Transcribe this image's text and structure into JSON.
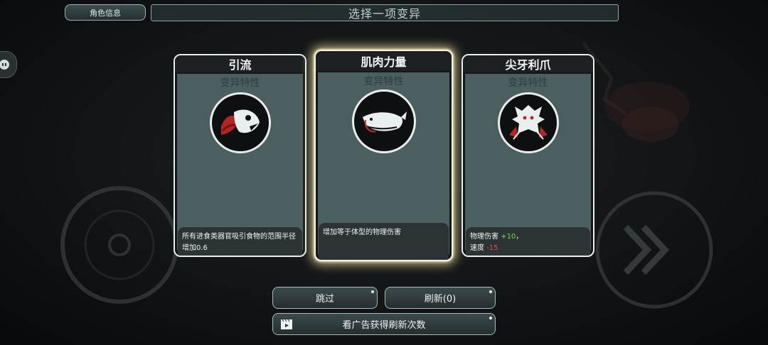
{
  "header": {
    "role_info_label": "角色信息",
    "title": "选择一项变异"
  },
  "cards": [
    {
      "title": "引流",
      "subtitle": "变异特性",
      "icon": "fish-head-emblem-icon",
      "description": "所有进食类器官吸引食物的范围半径增加0.6",
      "selected": false
    },
    {
      "title": "肌肉力量",
      "subtitle": "变异特性",
      "icon": "whale-emblem-icon",
      "description": "增加等于体型的物理伤害",
      "selected": true
    },
    {
      "title": "尖牙利爪",
      "subtitle": "变异特性",
      "icon": "beast-claws-emblem-icon",
      "stat1_label": "物理伤害",
      "stat1_value": "+10",
      "stat1_suffix": "，",
      "stat2_label": "速度",
      "stat2_value": "-15",
      "selected": false
    }
  ],
  "actions": {
    "skip_label": "跳过",
    "refresh_label": "刷新(0)",
    "watch_ad_label": "看广告获得刷新次数"
  },
  "colors": {
    "positive": "#78d85a",
    "negative": "#e04848",
    "selected_glow": "#e4d696"
  }
}
